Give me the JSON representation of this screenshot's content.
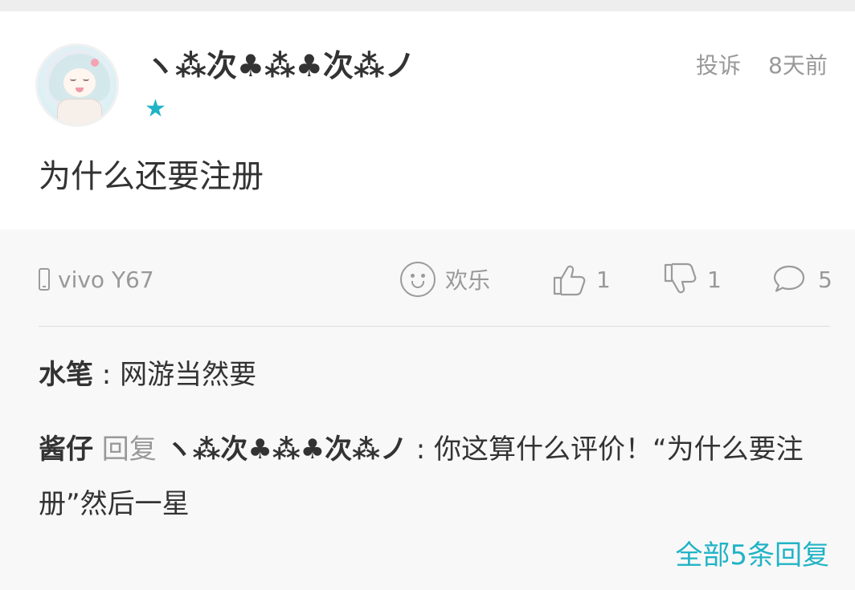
{
  "user": {
    "name": "ヽ⁂次♣⁂♣次⁂ノ",
    "badge_icon": "star-icon",
    "badge_color": "#21b3c6"
  },
  "header": {
    "report": "投诉",
    "time": "8天前"
  },
  "comment": {
    "content": "为什么还要注册"
  },
  "meta": {
    "device": "vivo Y67",
    "mood": "欢乐",
    "likes": "1",
    "dislikes": "1",
    "comments": "5"
  },
  "replies": [
    {
      "name": "水笔",
      "separator": " : ",
      "text": "网游当然要"
    },
    {
      "name": "酱仔",
      "verb": " 回复 ",
      "target": "ヽ⁂次♣⁂♣次⁂ノ",
      "separator": " : ",
      "text": "你这算什么评价！“为什么要注册”然后一星"
    }
  ],
  "footer": {
    "all_replies": "全部5条回复"
  },
  "colors": {
    "accent": "#21b3c6",
    "muted": "#999999",
    "text": "#333333"
  }
}
